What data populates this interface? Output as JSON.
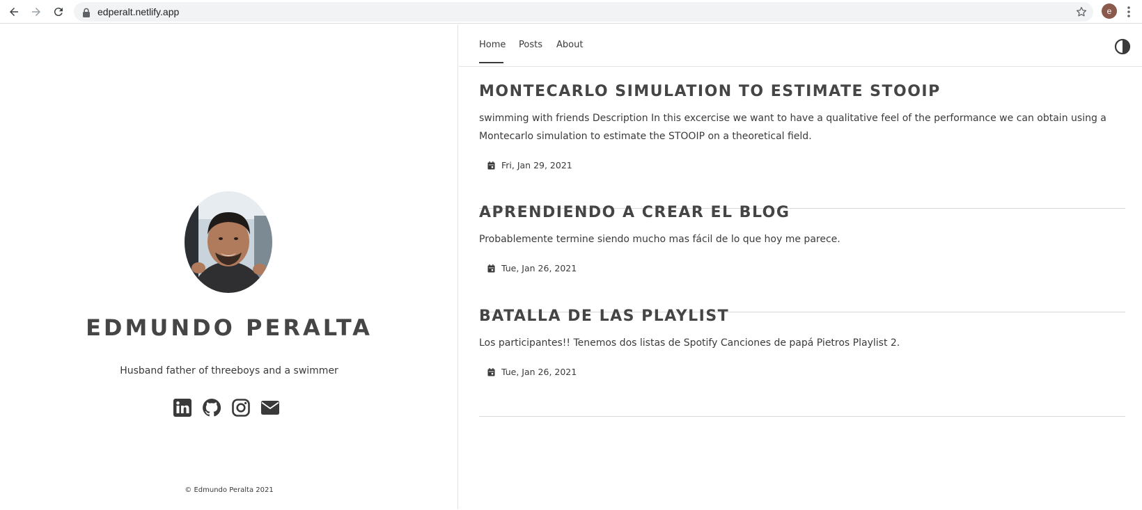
{
  "browser": {
    "url": "edperalt.netlify.app",
    "profile_initial": "e"
  },
  "sidebar": {
    "name": "EDMUNDO PERALTA",
    "bio": "Husband father of threeboys and a swimmer",
    "socials": [
      "linkedin-icon",
      "github-icon",
      "instagram-icon",
      "mail-icon"
    ],
    "copyright": "© Edmundo Peralta 2021"
  },
  "nav": {
    "items": [
      {
        "label": "Home",
        "active": true
      },
      {
        "label": "Posts",
        "active": false
      },
      {
        "label": "About",
        "active": false
      }
    ]
  },
  "posts": [
    {
      "title": "MONTECARLO SIMULATION TO ESTIMATE STOOIP",
      "description": "swimming with friends Description In this excercise we want to have a qualitative feel of the performance we can obtain using a Montecarlo simulation to estimate the STOOIP on a theoretical field.",
      "date": "Fri, Jan 29, 2021"
    },
    {
      "title": "APRENDIENDO A CREAR EL BLOG",
      "description": "Probablemente termine siendo mucho mas fácil de lo que hoy me parece.",
      "date": "Tue, Jan 26, 2021"
    },
    {
      "title": "BATALLA DE LAS PLAYLIST",
      "description": "Los participantes!! Tenemos dos listas de Spotify Canciones de papá Pietros Playlist 2.",
      "date": "Tue, Jan 26, 2021"
    }
  ]
}
